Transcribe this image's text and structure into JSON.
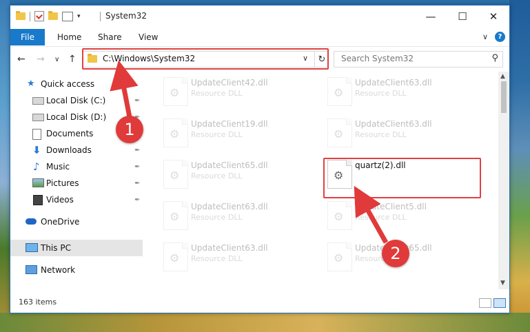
{
  "window": {
    "title": "System32",
    "minimize_glyph": "—",
    "maximize_glyph": "☐",
    "close_glyph": "✕"
  },
  "ribbon": {
    "tabs": [
      {
        "label": "File",
        "active": true
      },
      {
        "label": "Home"
      },
      {
        "label": "Share"
      },
      {
        "label": "View"
      }
    ],
    "collapse_glyph": "∨",
    "help_glyph": "?"
  },
  "nav": {
    "back_glyph": "←",
    "forward_glyph": "→",
    "recent_glyph": "∨",
    "up_glyph": "↑",
    "address": "C:\\Windows\\System32",
    "address_chevron": "∨",
    "refresh_glyph": "↻",
    "search_placeholder": "Search System32",
    "search_glyph": "⚲"
  },
  "sidebar": {
    "items": [
      {
        "label": "Quick access",
        "icon": "star-icon"
      },
      {
        "label": "Local Disk (C:)",
        "icon": "drive-icon",
        "pinned": true
      },
      {
        "label": "Local Disk (D:)",
        "icon": "drive-icon",
        "pinned": true
      },
      {
        "label": "Documents",
        "icon": "documents-icon",
        "pinned": true
      },
      {
        "label": "Downloads",
        "icon": "download-icon",
        "pinned": true
      },
      {
        "label": "Music",
        "icon": "music-icon",
        "pinned": true
      },
      {
        "label": "Pictures",
        "icon": "pictures-icon",
        "pinned": true
      },
      {
        "label": "Videos",
        "icon": "videos-icon",
        "pinned": true
      },
      {
        "label": "OneDrive",
        "icon": "cloud-icon"
      },
      {
        "label": "This PC",
        "icon": "computer-icon",
        "selected": true
      },
      {
        "label": "Network",
        "icon": "network-icon"
      }
    ],
    "pin_glyph": "📌"
  },
  "files": {
    "left": [
      {
        "name": "UpdateClient42.dll",
        "desc": "Resource DLL"
      },
      {
        "name": "UpdateClient19.dll",
        "desc": "Resource DLL"
      },
      {
        "name": "UpdateClient65.dll",
        "desc": "Resource DLL"
      },
      {
        "name": "UpdateClient63.dll",
        "desc": "Resource DLL"
      },
      {
        "name": "UpdateClient63.dll",
        "desc": "Resource DLL"
      }
    ],
    "right": [
      {
        "name": "UpdateClient63.dll",
        "desc": "Resource DLL"
      },
      {
        "name": "UpdateClient63.dll",
        "desc": "Resource DLL"
      },
      {
        "name": "quartz(2).dll",
        "desc": "",
        "highlighted": true
      },
      {
        "name": "UpdateClient5.dll",
        "desc": "Resource DLL"
      },
      {
        "name": "UpdateClient65.dll",
        "desc": "Resource DLL"
      }
    ],
    "gear_glyph": "⚙"
  },
  "status": {
    "items_count": "163 items"
  },
  "annotations": {
    "step1": "1",
    "step2": "2",
    "color": "#e03a3a"
  },
  "scroll": {
    "up_glyph": "▲",
    "down_glyph": "▼"
  }
}
